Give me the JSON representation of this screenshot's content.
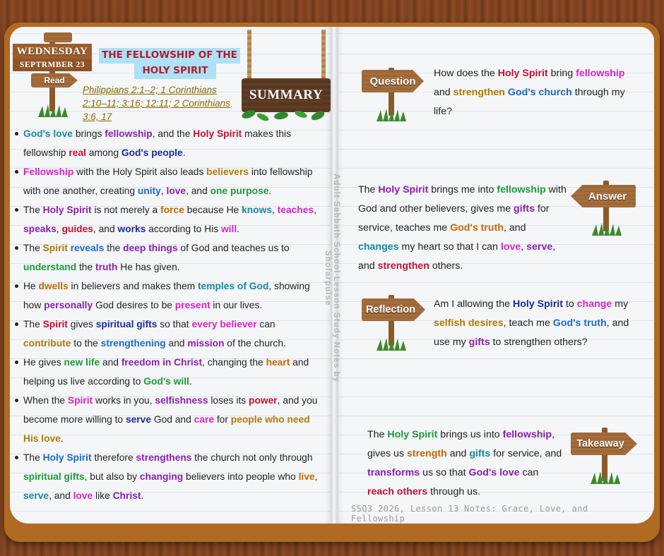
{
  "header": {
    "day": "WEDNESDAY",
    "date": "SEPTRMBER 23",
    "read_label": "Read",
    "title_line1": "THE FELLOWSHIP OF THE",
    "title_line2": "HOLY SPIRIT",
    "refs_line1": "Philippians 2:1–2; 1 Corinthians",
    "refs_line2": "2:10–11; 3:16; 12:11; 2 Corinthians",
    "refs_line3": "3:6, 17",
    "summary_label": "SUMMARY"
  },
  "spine_text": "Adult Sabbath School Lesson Study Notes by Shofarpulse",
  "colors": {
    "red": "#c8102e",
    "magenta": "#e020c8",
    "purple": "#8a1fb0",
    "teal": "#138a9a",
    "green": "#1c9a3a",
    "navy": "#1a2aa0",
    "orange": "#c06a00",
    "blue": "#1a6ac8",
    "gold": "#b07a00"
  },
  "bullets": [
    [
      [
        "God's love",
        "teal"
      ],
      [
        " brings ",
        ""
      ],
      [
        "fellowship",
        "purple"
      ],
      [
        ", and the ",
        ""
      ],
      [
        "Holy Spirit",
        "red"
      ],
      [
        " makes this fellowship ",
        ""
      ],
      [
        "real",
        "red"
      ],
      [
        " among ",
        ""
      ],
      [
        "God's people",
        "navy"
      ],
      [
        ".",
        ""
      ]
    ],
    [
      [
        "Fellowship",
        "magenta"
      ],
      [
        " with the Holy Spirit also leads ",
        ""
      ],
      [
        "believers",
        "gold"
      ],
      [
        " into fellowship with one another, creating ",
        ""
      ],
      [
        "unity",
        "blue"
      ],
      [
        ", ",
        ""
      ],
      [
        "love",
        "purple"
      ],
      [
        ", and ",
        ""
      ],
      [
        "one purpose",
        "green"
      ],
      [
        ".",
        ""
      ]
    ],
    [
      [
        "The ",
        ""
      ],
      [
        "Holy Spirit",
        "purple"
      ],
      [
        " is not merely a ",
        ""
      ],
      [
        "force",
        "orange"
      ],
      [
        " because He ",
        ""
      ],
      [
        "knows",
        "teal"
      ],
      [
        ", ",
        ""
      ],
      [
        "teaches",
        "magenta"
      ],
      [
        ", ",
        ""
      ],
      [
        "speaks",
        "purple"
      ],
      [
        ", ",
        ""
      ],
      [
        "guides",
        "red"
      ],
      [
        ", and ",
        ""
      ],
      [
        "works",
        "navy"
      ],
      [
        " according to His ",
        ""
      ],
      [
        "will",
        "magenta"
      ],
      [
        ".",
        ""
      ]
    ],
    [
      [
        "The ",
        ""
      ],
      [
        "Spirit",
        "gold"
      ],
      [
        " ",
        ""
      ],
      [
        "reveals",
        "blue"
      ],
      [
        " the ",
        ""
      ],
      [
        "deep things",
        "purple"
      ],
      [
        " of God and teaches us to ",
        ""
      ],
      [
        "understand",
        "green"
      ],
      [
        " the ",
        ""
      ],
      [
        "truth",
        "purple"
      ],
      [
        " He has given.",
        ""
      ]
    ],
    [
      [
        "He ",
        ""
      ],
      [
        "dwells",
        "orange"
      ],
      [
        " in believers and makes them ",
        ""
      ],
      [
        "temples of God",
        "teal"
      ],
      [
        ", showing how ",
        ""
      ],
      [
        "personally",
        "purple"
      ],
      [
        " God desires to be ",
        ""
      ],
      [
        "present",
        "magenta"
      ],
      [
        " in our lives.",
        ""
      ]
    ],
    [
      [
        "The ",
        ""
      ],
      [
        "Spirit",
        "red"
      ],
      [
        " gives ",
        ""
      ],
      [
        "spiritual gifts",
        "navy"
      ],
      [
        " so that ",
        ""
      ],
      [
        "every believer",
        "magenta"
      ],
      [
        " can ",
        ""
      ],
      [
        "contribute",
        "gold"
      ],
      [
        " to the ",
        ""
      ],
      [
        "strengthening",
        "blue"
      ],
      [
        " and ",
        ""
      ],
      [
        "mission",
        "purple"
      ],
      [
        " of the church.",
        ""
      ]
    ],
    [
      [
        "He gives ",
        ""
      ],
      [
        "new life",
        "green"
      ],
      [
        " and ",
        ""
      ],
      [
        "freedom in Christ",
        "purple"
      ],
      [
        ", changing the ",
        ""
      ],
      [
        "heart",
        "orange"
      ],
      [
        " and helping us live according to ",
        ""
      ],
      [
        "God's will",
        "green"
      ],
      [
        ".",
        ""
      ]
    ],
    [
      [
        "When the ",
        ""
      ],
      [
        "Spirit",
        "magenta"
      ],
      [
        " works in you, ",
        ""
      ],
      [
        "selfishness",
        "purple"
      ],
      [
        " loses its ",
        ""
      ],
      [
        "power",
        "red"
      ],
      [
        ", and you become more willing to ",
        ""
      ],
      [
        "serve",
        "navy"
      ],
      [
        " God and ",
        ""
      ],
      [
        "care",
        "magenta"
      ],
      [
        " for ",
        ""
      ],
      [
        "people who need His love",
        "gold"
      ],
      [
        ".",
        ""
      ]
    ],
    [
      [
        "The ",
        ""
      ],
      [
        "Holy Spirit",
        "blue"
      ],
      [
        " therefore ",
        ""
      ],
      [
        "strengthens",
        "purple"
      ],
      [
        " the church not only through ",
        ""
      ],
      [
        "spiritual gifts",
        "green"
      ],
      [
        ", but also by ",
        ""
      ],
      [
        "changing",
        "purple"
      ],
      [
        " believers into people who ",
        ""
      ],
      [
        "live",
        "orange"
      ],
      [
        ", ",
        ""
      ],
      [
        "serve",
        "teal"
      ],
      [
        ", and ",
        ""
      ],
      [
        "love",
        "magenta"
      ],
      [
        " like ",
        ""
      ],
      [
        "Christ",
        "purple"
      ],
      [
        ".",
        ""
      ]
    ]
  ],
  "question": {
    "label": "Question",
    "text": [
      [
        "How does the ",
        ""
      ],
      [
        "Holy Spirit",
        "red"
      ],
      [
        " bring ",
        ""
      ],
      [
        "fellowship",
        "magenta"
      ],
      [
        " and ",
        ""
      ],
      [
        "strengthen",
        "gold"
      ],
      [
        " ",
        ""
      ],
      [
        "God's church",
        "blue"
      ],
      [
        " through my life?",
        ""
      ]
    ]
  },
  "answer": {
    "label": "Answer",
    "text": [
      [
        "The ",
        ""
      ],
      [
        "Holy Spirit",
        "purple"
      ],
      [
        " brings me into ",
        ""
      ],
      [
        "fellowship",
        "green"
      ],
      [
        " with God and other believers, gives me ",
        ""
      ],
      [
        "gifts",
        "purple"
      ],
      [
        " for service, teaches me ",
        ""
      ],
      [
        "God's truth",
        "orange"
      ],
      [
        ", and ",
        ""
      ],
      [
        "changes",
        "teal"
      ],
      [
        " my heart so that I can ",
        ""
      ],
      [
        "love",
        "magenta"
      ],
      [
        ", ",
        ""
      ],
      [
        "serve",
        "purple"
      ],
      [
        ", and ",
        ""
      ],
      [
        "strengthen",
        "red"
      ],
      [
        " others.",
        ""
      ]
    ]
  },
  "reflection": {
    "label": "Reflection",
    "text": [
      [
        "Am I allowing the ",
        ""
      ],
      [
        "Holy Spirit",
        "navy"
      ],
      [
        " to ",
        ""
      ],
      [
        "change",
        "magenta"
      ],
      [
        " my ",
        ""
      ],
      [
        "selfish desires",
        "gold"
      ],
      [
        ", teach me ",
        ""
      ],
      [
        "God's truth",
        "blue"
      ],
      [
        ", and use my ",
        ""
      ],
      [
        "gifts",
        "purple"
      ],
      [
        " to strengthen others?",
        ""
      ]
    ]
  },
  "takeaway": {
    "label": "Takeaway",
    "text": [
      [
        "The ",
        ""
      ],
      [
        "Holy Spirit",
        "green"
      ],
      [
        " brings us into ",
        ""
      ],
      [
        "fellowship",
        "purple"
      ],
      [
        ", gives us ",
        ""
      ],
      [
        "strength",
        "orange"
      ],
      [
        " and ",
        ""
      ],
      [
        "gifts",
        "teal"
      ],
      [
        " for service, and ",
        ""
      ],
      [
        "transforms",
        "purple"
      ],
      [
        " us so that ",
        ""
      ],
      [
        "God's love",
        "purple"
      ],
      [
        " can ",
        ""
      ],
      [
        "reach others",
        "red"
      ],
      [
        " through us.",
        ""
      ]
    ]
  },
  "footer": "SSQ3 2026, Lesson 13 Notes: Grace, Love, and Fellowship"
}
